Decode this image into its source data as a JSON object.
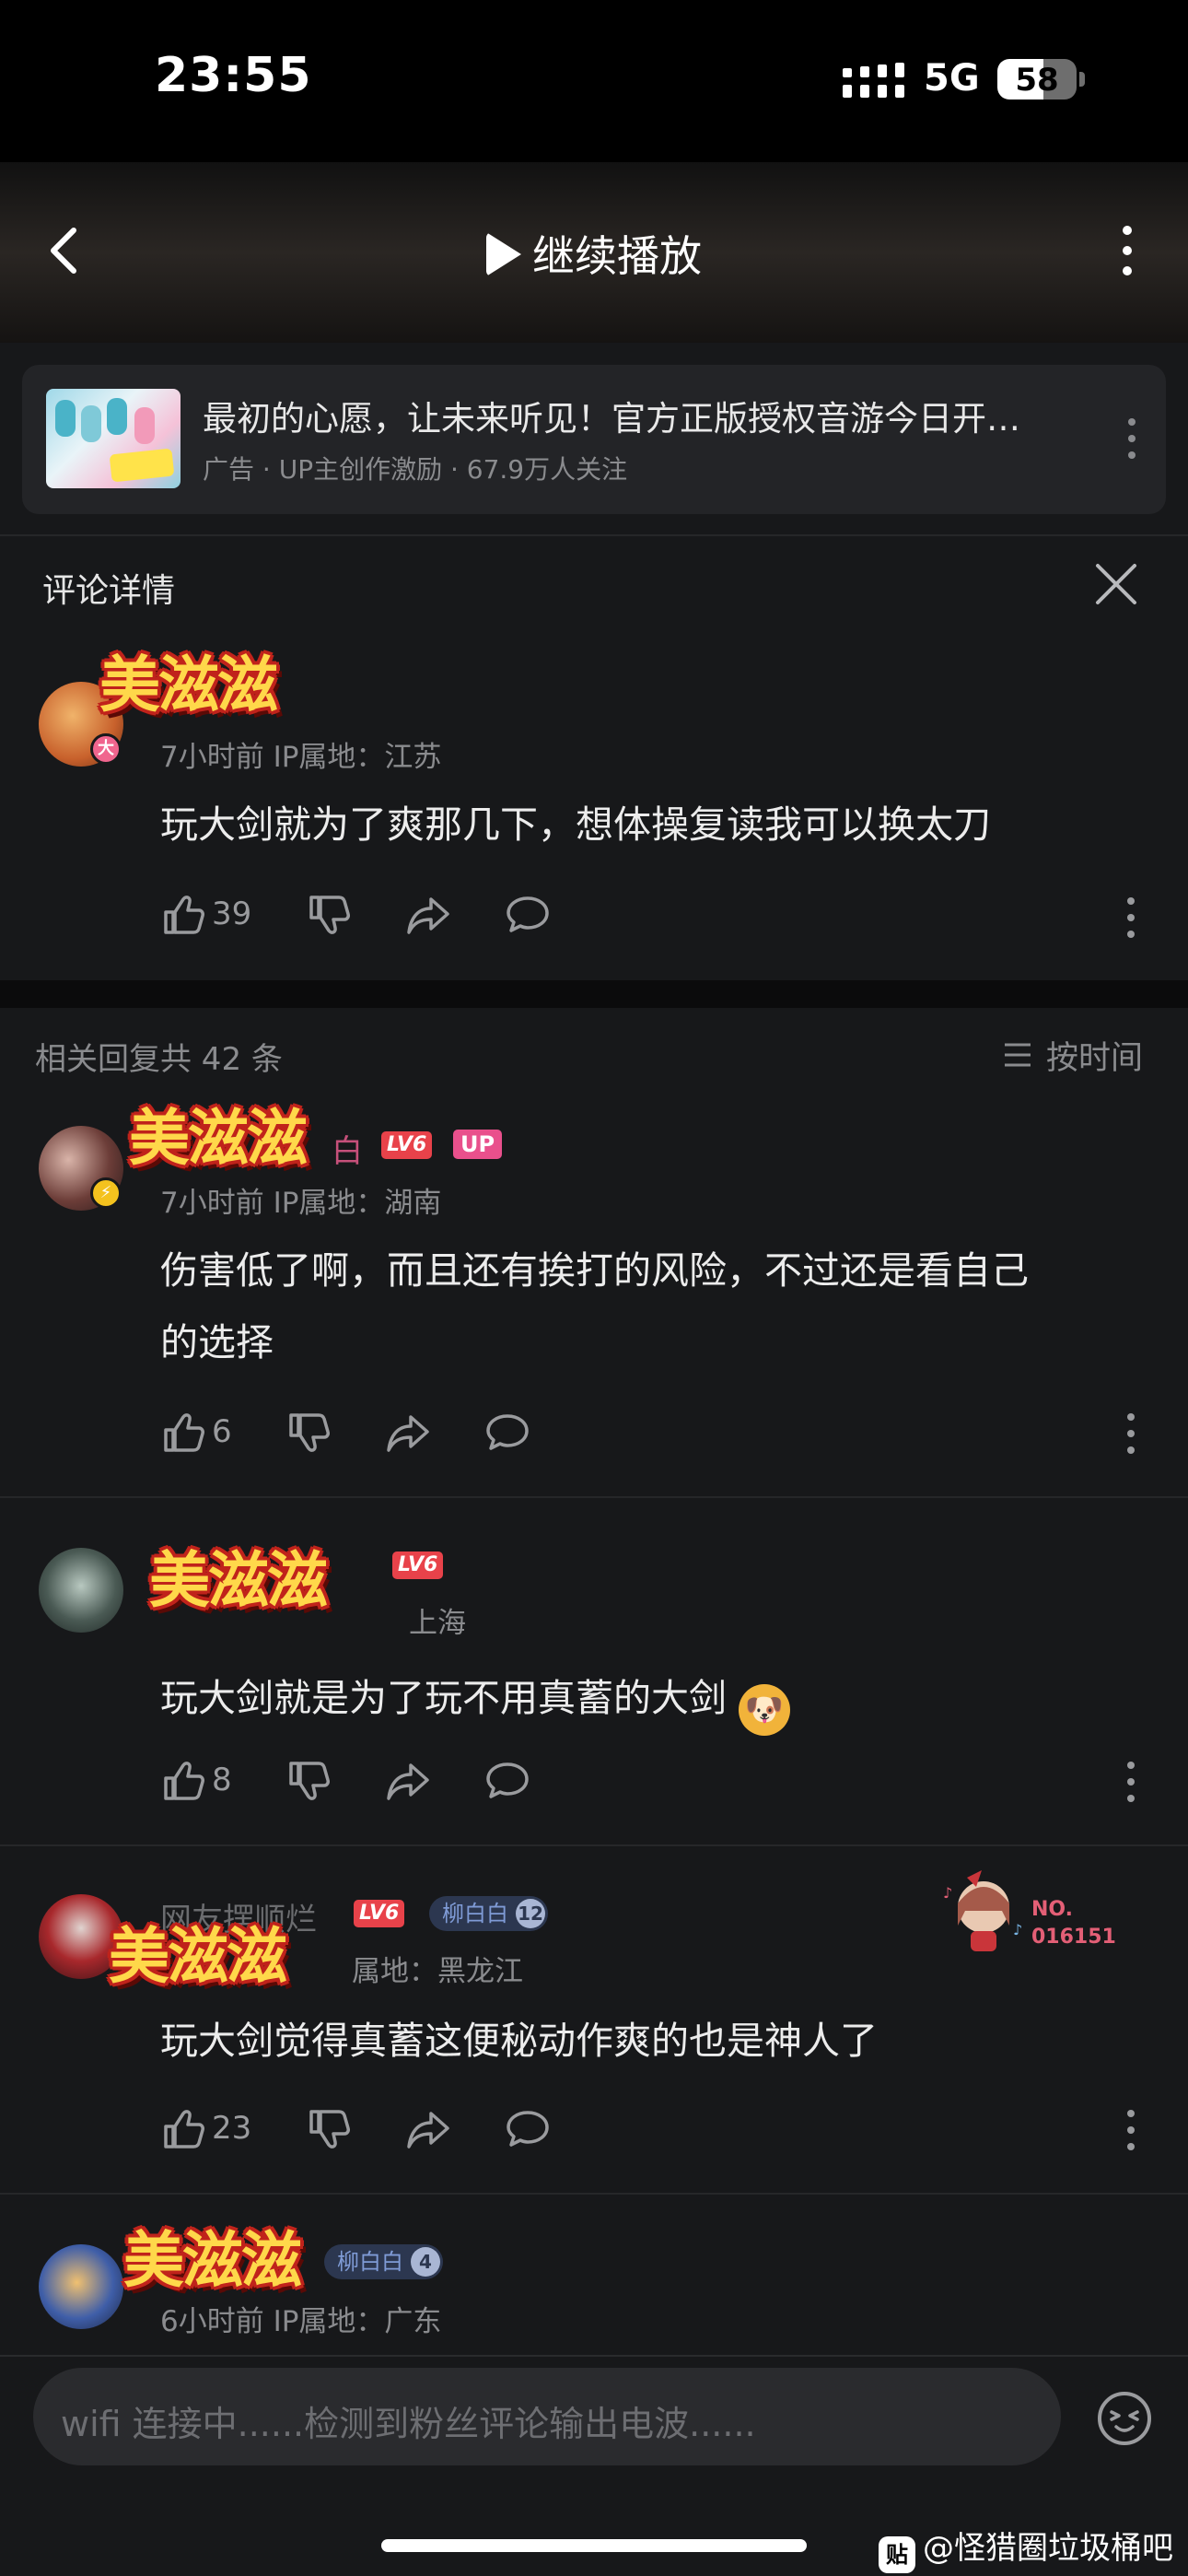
{
  "status": {
    "time": "23:55",
    "network": "5G",
    "battery": "58",
    "battery_level": 0.58
  },
  "header": {
    "title": "继续播放",
    "back_icon": "chevron-left-icon",
    "more_icon": "more-vertical-icon"
  },
  "ad": {
    "title": "最初的心愿，让未来听见！官方正版授权音游今日开…",
    "subtitle": "广告 · UP主创作激励 · 67.9万人关注"
  },
  "detail": {
    "title": "评论详情"
  },
  "sticker_text": "美滋滋",
  "main_comment": {
    "badge": "大",
    "meta": "7小时前  IP属地：江苏",
    "text": "玩大剑就为了爽那几下，想体操复读我可以换太刀",
    "likes": "39"
  },
  "replies_header": {
    "count_text": "相关回复共 42 条",
    "sort_label": "按时间"
  },
  "replies": [
    {
      "name_partial": "白",
      "level": "LV6",
      "up": "UP",
      "meta": "7小时前  IP属地：湖南",
      "text_line1": "伤害低了啊，而且还有挨打的风险，不过还是看自己",
      "text_line2": "的选择",
      "likes": "6"
    },
    {
      "level": "LV6",
      "meta_partial": "上海",
      "text": "玩大剑就是为了玩不用真蓄的大剑",
      "likes": "8"
    },
    {
      "name_partial": "网友摆顺烂",
      "level": "LV6",
      "fan_name": "柳白白",
      "fan_level": "12",
      "meta_partial": "属地：黑龙江",
      "text": "玩大剑觉得真蓄这便秘动作爽的也是神人了",
      "likes": "23",
      "no_badge_line1": "NO.",
      "no_badge_line2": "016151"
    },
    {
      "fan_name": "柳白白",
      "fan_level": "4",
      "meta": "6小时前  IP属地：广东"
    }
  ],
  "input": {
    "placeholder": "wifi 连接中......检测到粉丝评论输出电波......"
  },
  "watermark": {
    "logo": "贴",
    "text": "@怪猎圈垃圾桶吧"
  }
}
